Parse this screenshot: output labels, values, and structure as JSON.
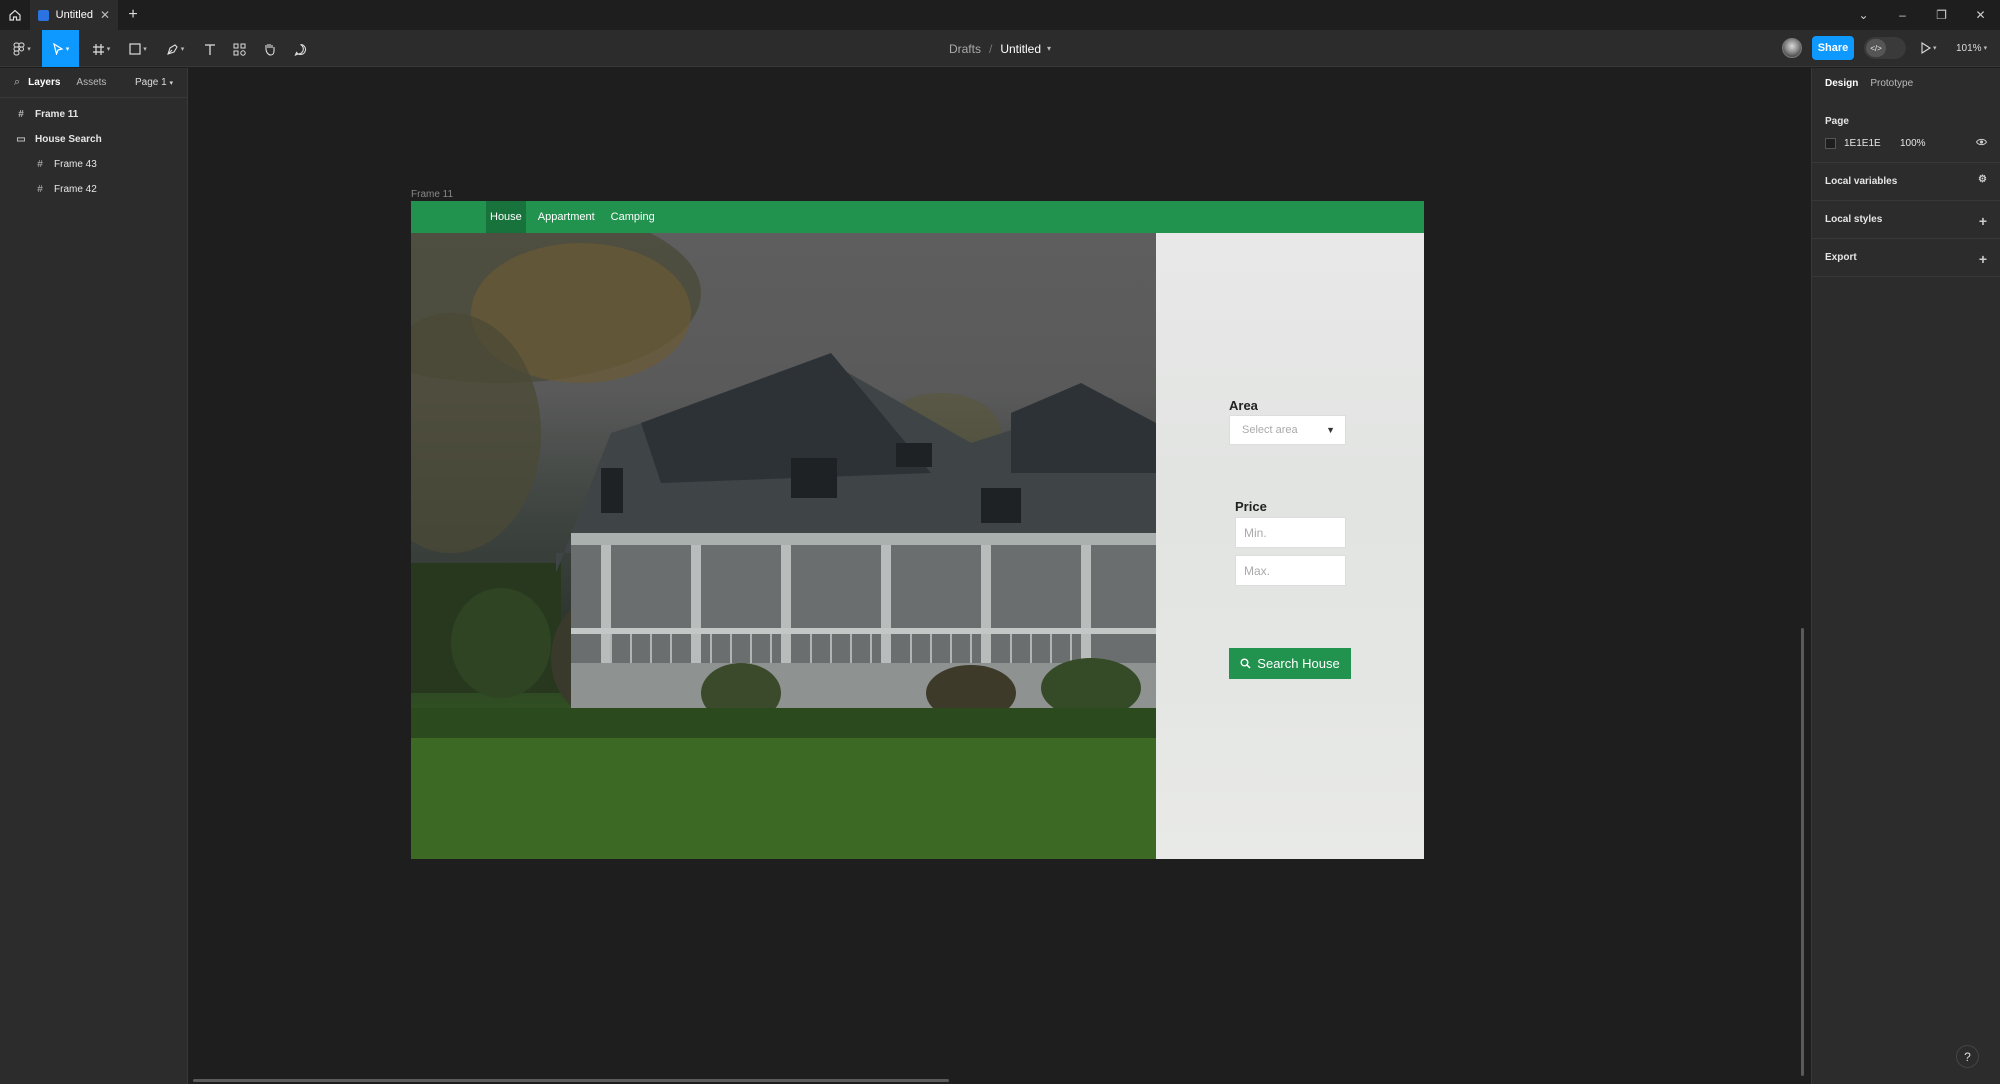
{
  "tabbar": {
    "tab_title": "Untitled",
    "close_glyph": "✕",
    "new_tab_glyph": "+",
    "window_controls": [
      "⌄",
      "–",
      "❐",
      "✕"
    ]
  },
  "toolbar": {
    "breadcrumb_parent": "Drafts",
    "breadcrumb_sep": "/",
    "file_name": "Untitled",
    "share_label": "Share",
    "zoom_label": "101%"
  },
  "left_panel": {
    "tabs": {
      "layers": "Layers",
      "assets": "Assets"
    },
    "page_selector": "Page 1",
    "layers": [
      {
        "name": "Frame 11",
        "icon": "frame-icon"
      },
      {
        "name": "House Search",
        "icon": "section-icon"
      },
      {
        "name": "Frame 43",
        "icon": "frame-icon"
      },
      {
        "name": "Frame 42",
        "icon": "frame-icon"
      }
    ]
  },
  "right_panel": {
    "tabs": {
      "design": "Design",
      "prototype": "Prototype"
    },
    "page_section": {
      "title": "Page",
      "color_hex": "1E1E1E",
      "opacity": "100%"
    },
    "local_variables": "Local variables",
    "local_styles": "Local styles",
    "export": "Export"
  },
  "canvas": {
    "frame_label": "Frame 11",
    "nav": {
      "items": [
        "House",
        "Appartment",
        "Camping"
      ],
      "active_index": 0
    },
    "form": {
      "area_label": "Area",
      "area_placeholder": "Select area",
      "price_label": "Price",
      "min_placeholder": "Min.",
      "max_placeholder": "Max.",
      "search_button": "Search House"
    }
  },
  "help_glyph": "?",
  "colors": {
    "accent_blue": "#0d99ff",
    "brand_green": "#22924f",
    "active_nav_green": "#17723b",
    "canvas_bg": "#1e1e1e",
    "panel_bg": "#2c2c2c"
  }
}
